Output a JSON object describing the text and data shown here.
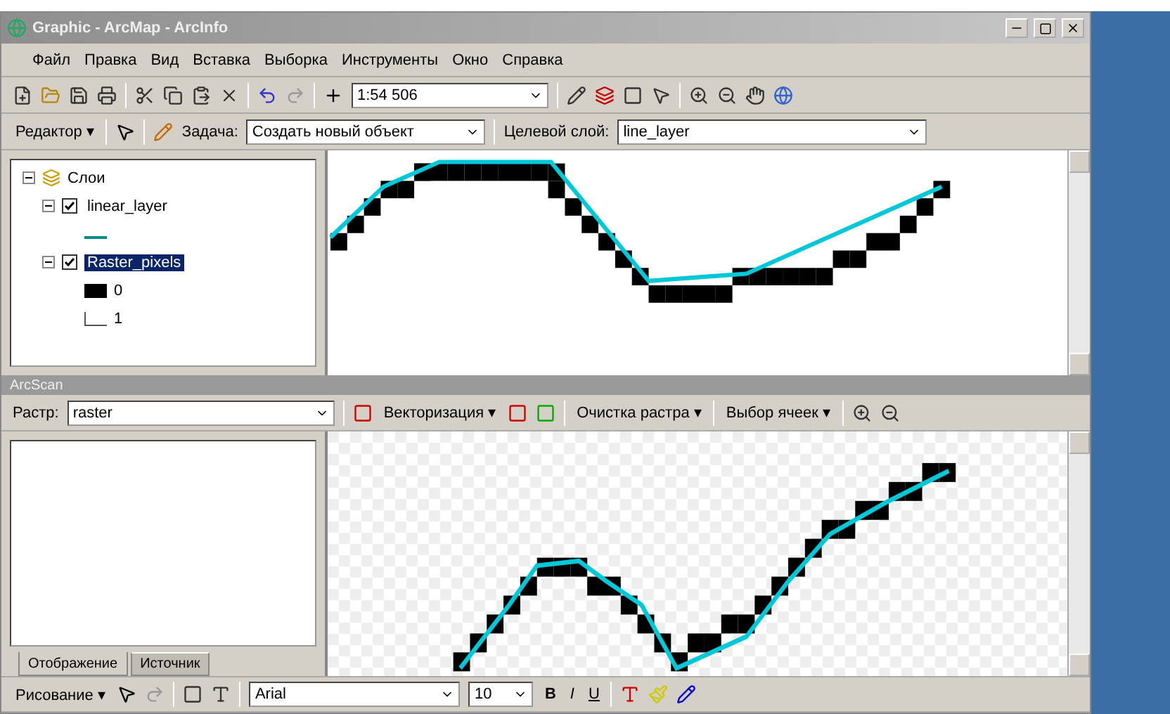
{
  "window": {
    "title": "Graphic - ArcMap - ArcInfo"
  },
  "menu": [
    "Файл",
    "Правка",
    "Вид",
    "Вставка",
    "Выборка",
    "Инструменты",
    "Окно",
    "Справка"
  ],
  "standard_toolbar": {
    "scale": "1:54 506"
  },
  "editor_toolbar": {
    "editor": "Редактор ▾",
    "task_label": "Задача:",
    "task": "Создать новый объект",
    "target_label": "Целевой слой:",
    "target": "line_layer"
  },
  "toc": {
    "root": {
      "label": "Слои",
      "expanded": true,
      "children": [
        {
          "label": "linear_layer",
          "checked": true,
          "expanded": true,
          "selected": false,
          "legend": [
            {
              "kind": "line"
            }
          ]
        },
        {
          "label": "Raster_pixels",
          "checked": true,
          "expanded": true,
          "selected": true,
          "legend": [
            {
              "kind": "fill",
              "label": "0"
            },
            {
              "kind": "empty",
              "label": "1"
            }
          ]
        }
      ]
    }
  },
  "arcscan": {
    "title": "ArcScan",
    "raster_label": "Растр:",
    "raster": "raster",
    "menus": [
      "Векторизация ▾",
      "Очистка растра ▾",
      "Выбор ячеек ▾"
    ]
  },
  "toc_tabs": [
    {
      "label": "Отображение",
      "selected": true
    },
    {
      "label": "Источник",
      "selected": false
    }
  ],
  "drawing_toolbar": {
    "drawing": "Рисование ▾",
    "font": "Arial",
    "size": "10",
    "styles": [
      "B",
      "I",
      "U"
    ]
  }
}
